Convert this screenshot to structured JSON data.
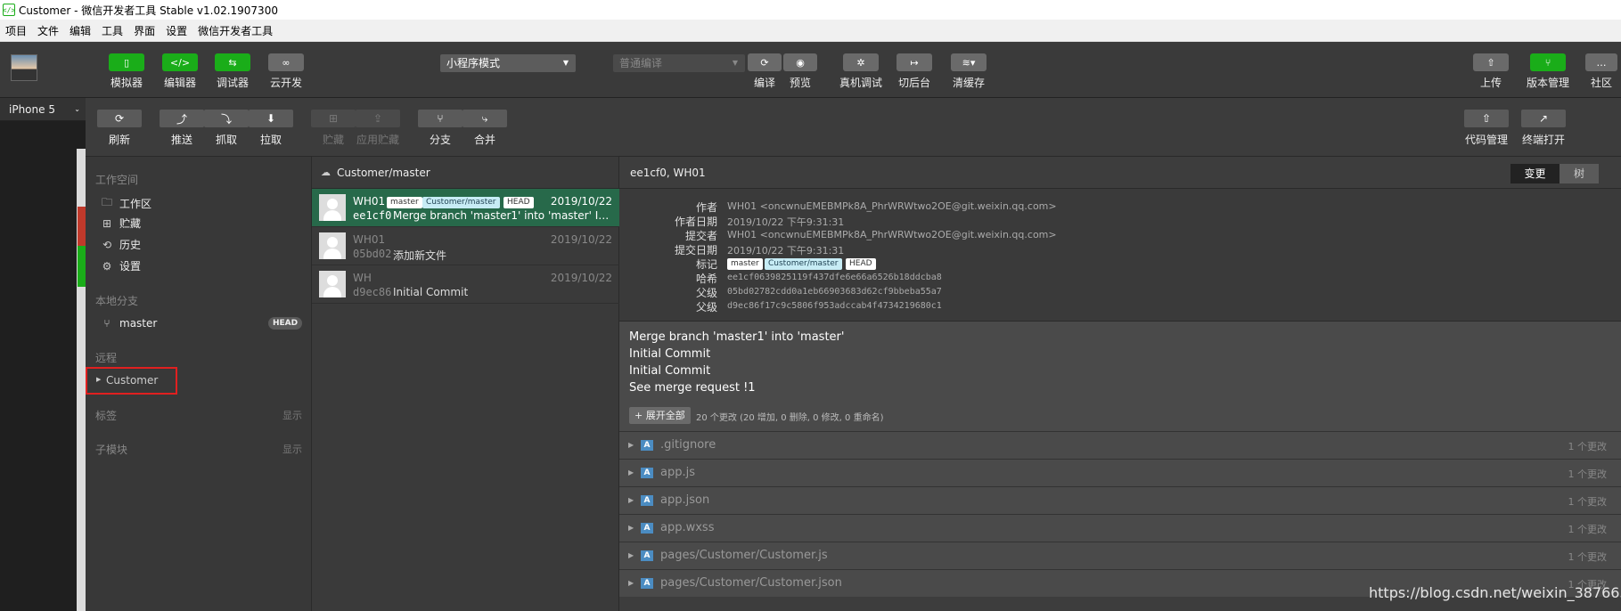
{
  "window": {
    "title": "Customer - 微信开发者工具 Stable v1.02.1907300"
  },
  "menu": [
    "项目",
    "文件",
    "编辑",
    "工具",
    "界面",
    "设置",
    "微信开发者工具"
  ],
  "toolbar": {
    "simulator": "模拟器",
    "editor": "编辑器",
    "debugger": "调试器",
    "cloud": "云开发",
    "mode": "小程序模式",
    "compile_mode": "普通编译",
    "compile": "编译",
    "preview": "预览",
    "remote_debug": "真机调试",
    "background": "切后台",
    "clear_cache": "清缓存",
    "upload": "上传",
    "version_mgmt": "版本管理",
    "community": "社区",
    "accent": "#1aad19"
  },
  "device": "iPhone 5",
  "vtoolbar": {
    "refresh": "刷新",
    "push": "推送",
    "fetch": "抓取",
    "pull": "拉取",
    "stash": "贮藏",
    "apply_stash": "应用贮藏",
    "branch": "分支",
    "merge": "合并",
    "code_mgmt": "代码管理",
    "terminal_open": "终端打开"
  },
  "sidebar": {
    "workspace_title": "工作空间",
    "workspace_items": [
      {
        "label": "工作区",
        "icon": "folder-icon"
      },
      {
        "label": "贮藏",
        "icon": "stash-icon"
      },
      {
        "label": "历史",
        "icon": "history-icon"
      },
      {
        "label": "设置",
        "icon": "gear-icon"
      }
    ],
    "local_branch_title": "本地分支",
    "branch": "master",
    "head_badge": "HEAD",
    "remote_title": "远程",
    "remote_item": "Customer",
    "tags_title": "标签",
    "tags_show": "显示",
    "submodule_title": "子模块",
    "submodule_show": "显示"
  },
  "commit_list": {
    "header": "Customer/master",
    "commits": [
      {
        "author": "WH01",
        "date": "2019/10/22",
        "hash": "ee1cf0",
        "message": "Merge branch 'master1' into 'master' Initial C...",
        "tags": [
          "master",
          "Customer/master",
          "HEAD"
        ]
      },
      {
        "author": "WH01",
        "date": "2019/10/22",
        "hash": "05bd02",
        "message": "添加新文件"
      },
      {
        "author": "WH",
        "date": "2019/10/22",
        "hash": "d9ec86",
        "message": "Initial Commit"
      }
    ]
  },
  "detail": {
    "header": "ee1cf0, WH01",
    "tab_changes": "变更",
    "tab_tree": "树",
    "meta": {
      "author_label": "作者",
      "author": "WH01 <oncwnuEMEBMPk8A_PhrWRWtwo2OE@git.weixin.qq.com>",
      "author_date_label": "作者日期",
      "author_date": "2019/10/22 下午9:31:31",
      "committer_label": "提交者",
      "committer": "WH01 <oncwnuEMEBMPk8A_PhrWRWtwo2OE@git.weixin.qq.com>",
      "commit_date_label": "提交日期",
      "commit_date": "2019/10/22 下午9:31:31",
      "tags_label": "标记",
      "tags": [
        "master",
        "Customer/master",
        "HEAD"
      ],
      "hash_label": "哈希",
      "hash": "ee1cf0639825119f437dfe6e66a6526b18ddcba8",
      "parent_label": "父级",
      "parent1": "05bd02782cdd0a1eb66903683d62cf9bbeba55a7",
      "parent2": "d9ec86f17c9c5806f953adccab4f4734219680c1"
    },
    "message_lines": [
      "Merge branch 'master1' into 'master'",
      "Initial Commit",
      "Initial Commit",
      "See merge request !1"
    ],
    "expand_all": "+ 展开全部",
    "changes_summary": "20 个更改 (20 增加, 0 删除, 0 修改, 0 重命名)",
    "file_badge": "A",
    "files": [
      {
        "name": ".gitignore",
        "count": "1 个更改"
      },
      {
        "name": "app.js",
        "count": "1 个更改"
      },
      {
        "name": "app.json",
        "count": "1 个更改"
      },
      {
        "name": "app.wxss",
        "count": "1 个更改"
      },
      {
        "name": "pages/Customer/Customer.js",
        "count": "1 个更改"
      },
      {
        "name": "pages/Customer/Customer.json",
        "count": "1 个更改"
      }
    ]
  },
  "watermark": "https://blog.csdn.net/weixin_38766561"
}
